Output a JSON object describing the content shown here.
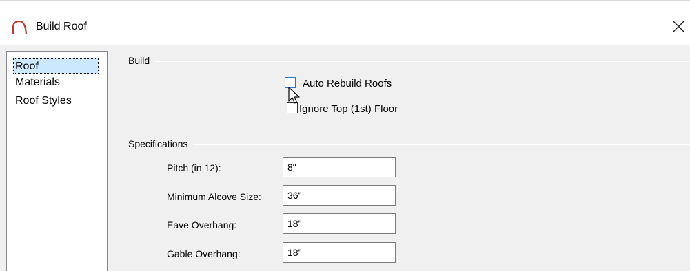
{
  "window": {
    "title": "Build Roof",
    "close_glyph": "✕"
  },
  "nav": {
    "items": [
      {
        "label": "Roof",
        "selected": true
      },
      {
        "label": "Materials",
        "selected": false
      },
      {
        "label": "Roof Styles",
        "selected": false
      }
    ]
  },
  "build_group": {
    "label": "Build",
    "auto_rebuild": {
      "label": "Auto Rebuild Roofs",
      "checked": false
    },
    "ignore_top": {
      "label": "Ignore Top (1st) Floor",
      "checked": false
    }
  },
  "specs_group": {
    "label": "Specifications",
    "fields": [
      {
        "label": "Pitch (in 12):",
        "value": "8\""
      },
      {
        "label": "Minimum Alcove Size:",
        "value": "36\""
      },
      {
        "label": "Eave Overhang:",
        "value": "18\""
      },
      {
        "label": "Gable Overhang:",
        "value": "18\""
      }
    ]
  },
  "icons": {
    "app": "roof-arc-icon",
    "close": "close-icon",
    "cursor": "mouse-pointer-icon"
  },
  "colors": {
    "selection": "#cce8ff",
    "app_icon": "#c0392b",
    "hover_border": "#1a7cd8"
  }
}
